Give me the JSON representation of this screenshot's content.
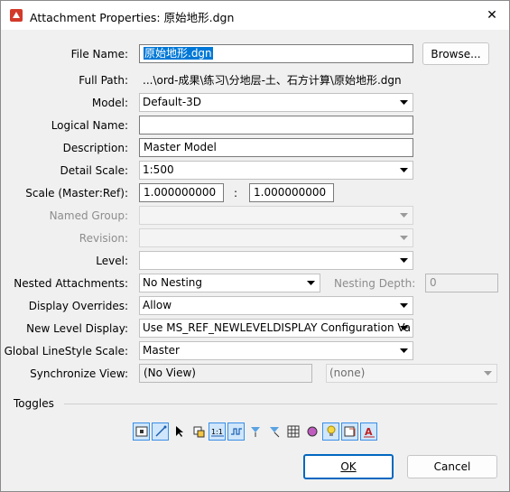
{
  "window": {
    "title": "Attachment Properties: 原始地形.dgn",
    "close_symbol": "✕"
  },
  "form": {
    "file_name": {
      "label": "File Name:",
      "value": "原始地形.dgn"
    },
    "browse_button": "Browse...",
    "full_path": {
      "label": "Full Path:",
      "value": "...\\ord-成果\\练习\\分地层-土、石方计算\\原始地形.dgn"
    },
    "model": {
      "label": "Model:",
      "value": "Default-3D"
    },
    "logical_name": {
      "label": "Logical Name:",
      "value": ""
    },
    "description": {
      "label": "Description:",
      "value": "Master Model"
    },
    "detail_scale": {
      "label": "Detail Scale:",
      "value": "1:500"
    },
    "scale": {
      "label": "Scale (Master:Ref):",
      "master": "1.000000000",
      "separator": ":",
      "ref": "1.000000000"
    },
    "named_group": {
      "label": "Named Group:",
      "value": ""
    },
    "revision": {
      "label": "Revision:",
      "value": ""
    },
    "level": {
      "label": "Level:",
      "value": ""
    },
    "nested_attachments": {
      "label": "Nested Attachments:",
      "value": "No Nesting"
    },
    "nesting_depth": {
      "label": "Nesting Depth:",
      "value": "0"
    },
    "display_overrides": {
      "label": "Display Overrides:",
      "value": "Allow"
    },
    "new_level_display": {
      "label": "New Level Display:",
      "value": "Use MS_REF_NEWLEVELDISPLAY Configuration Va"
    },
    "global_linestyle_scale": {
      "label": "Global LineStyle Scale:",
      "value": "Master"
    },
    "synchronize_view": {
      "label": "Synchronize View:",
      "value": "(No View)",
      "secondary": "(none)"
    }
  },
  "toggles": {
    "label": "Toggles",
    "items": [
      {
        "name": "display-toggle-icon",
        "on": true
      },
      {
        "name": "snap-toggle-icon",
        "on": true
      },
      {
        "name": "locate-toggle-icon",
        "on": false
      },
      {
        "name": "lock-toggle-icon",
        "on": false
      },
      {
        "name": "scale-line-styles-toggle-icon",
        "on": true
      },
      {
        "name": "line-style-toggle-icon",
        "on": true
      },
      {
        "name": "clip-toggle-icon",
        "on": false
      },
      {
        "name": "clip-back-toggle-icon",
        "on": false
      },
      {
        "name": "raster-toggle-icon",
        "on": false
      },
      {
        "name": "treat-as-element-toggle-icon",
        "on": false
      },
      {
        "name": "use-lights-toggle-icon",
        "on": true
      },
      {
        "name": "annotation-toggle-icon",
        "on": true
      },
      {
        "name": "text-style-toggle-icon",
        "on": true
      }
    ]
  },
  "buttons": {
    "ok": "OK",
    "cancel": "Cancel"
  },
  "colors": {
    "accent": "#0067c0",
    "selection": "#0078d7"
  }
}
